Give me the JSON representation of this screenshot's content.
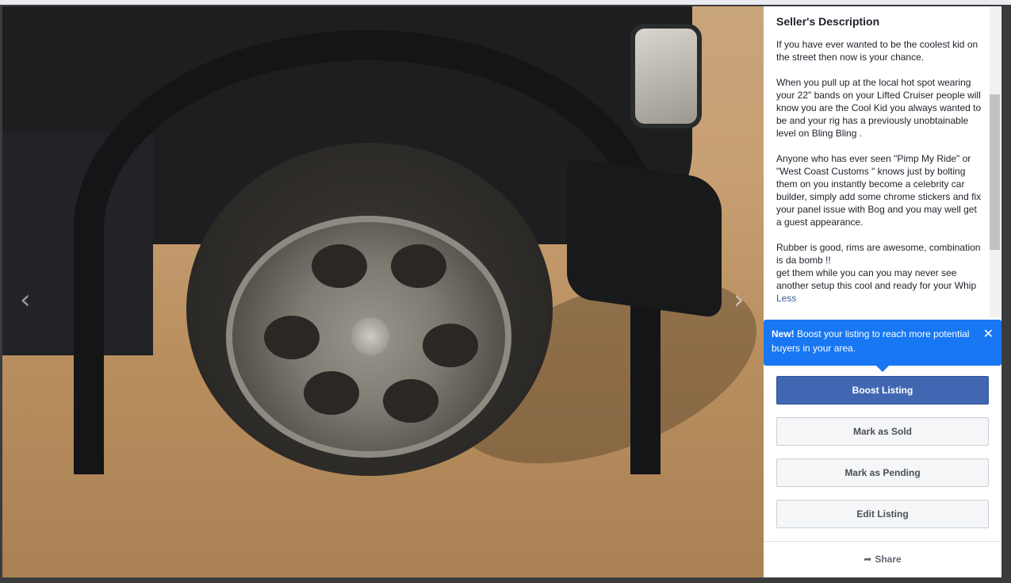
{
  "photo": {
    "prev_icon": "chevron-left-icon",
    "next_icon": "chevron-right-icon",
    "prev_glyph": "‹",
    "next_glyph": "›"
  },
  "description": {
    "title": "Seller's Description",
    "body": "If you have ever wanted to be the coolest kid on the street then now is your chance.\n\nWhen you pull up at the local hot spot wearing your 22\" bands on your Lifted Cruiser people will know you are the Cool Kid you always wanted to be and your rig has a previously unobtainable level on Bling Bling .\n\nAnyone who has  ever seen \"Pimp My Ride\" or \"West Coast Customs \" knows just by bolting them on you instantly become a celebrity car builder, simply add some chrome stickers and fix your panel issue with Bog and you may well get a guest appearance.\n\nRubber is good, rims are awesome, combination is da bomb !!\nget them while you can you may never see another setup this cool and ready for your Whip ",
    "less_label": "Less"
  },
  "tooltip": {
    "bold": "New!",
    "text": " Boost your listing to reach more potential buyers in your area.",
    "close_glyph": "✕",
    "bg_color": "#1877f2"
  },
  "actions": {
    "boost": "Boost Listing",
    "mark_sold": "Mark as Sold",
    "mark_pending": "Mark as Pending",
    "edit": "Edit Listing"
  },
  "share": {
    "icon": "share-arrow-icon",
    "glyph": "➦",
    "label": "Share"
  },
  "colors": {
    "primary_button": "#4267b2",
    "link": "#385898"
  }
}
